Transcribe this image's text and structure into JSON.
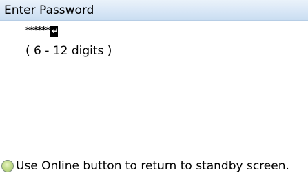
{
  "header": {
    "title": "Enter Password"
  },
  "password": {
    "masked_value": "******",
    "cursor_icon": "enter-return-icon"
  },
  "hint": {
    "text": "( 6 - 12 digits )"
  },
  "footer": {
    "icon": "online-button-icon",
    "icon_color": "#b9d57f",
    "text": "Use Online button to return to standby screen."
  },
  "colors": {
    "titlebar": "#d7e6f6",
    "background": "#ffffff",
    "text": "#000000"
  }
}
